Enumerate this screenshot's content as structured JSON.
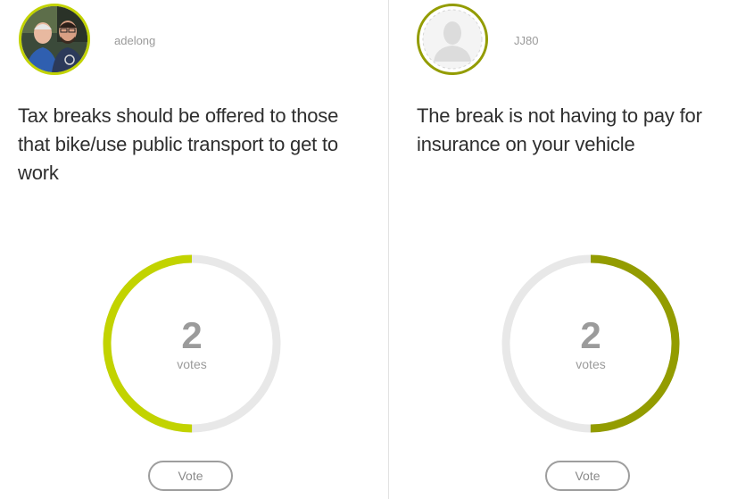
{
  "colors": {
    "left_accent": "#c2d300",
    "right_accent": "#939c00",
    "track": "#e8e8e8",
    "count_text": "#9b9b9b"
  },
  "cards": [
    {
      "username": "adelong",
      "avatar_icon": "user-photo",
      "statement": "Tax breaks should be offered to those that bike/use public transport to get to work",
      "votes": "2",
      "votes_label": "votes",
      "progress_fraction": 0.5,
      "progress_direction": "counterclockwise",
      "vote_label": "Vote"
    },
    {
      "username": "JJ80",
      "avatar_icon": "default-user-silhouette-icon",
      "statement": "The break is not having to pay for insurance on your vehicle",
      "votes": "2",
      "votes_label": "votes",
      "progress_fraction": 0.5,
      "progress_direction": "clockwise",
      "vote_label": "Vote"
    }
  ]
}
